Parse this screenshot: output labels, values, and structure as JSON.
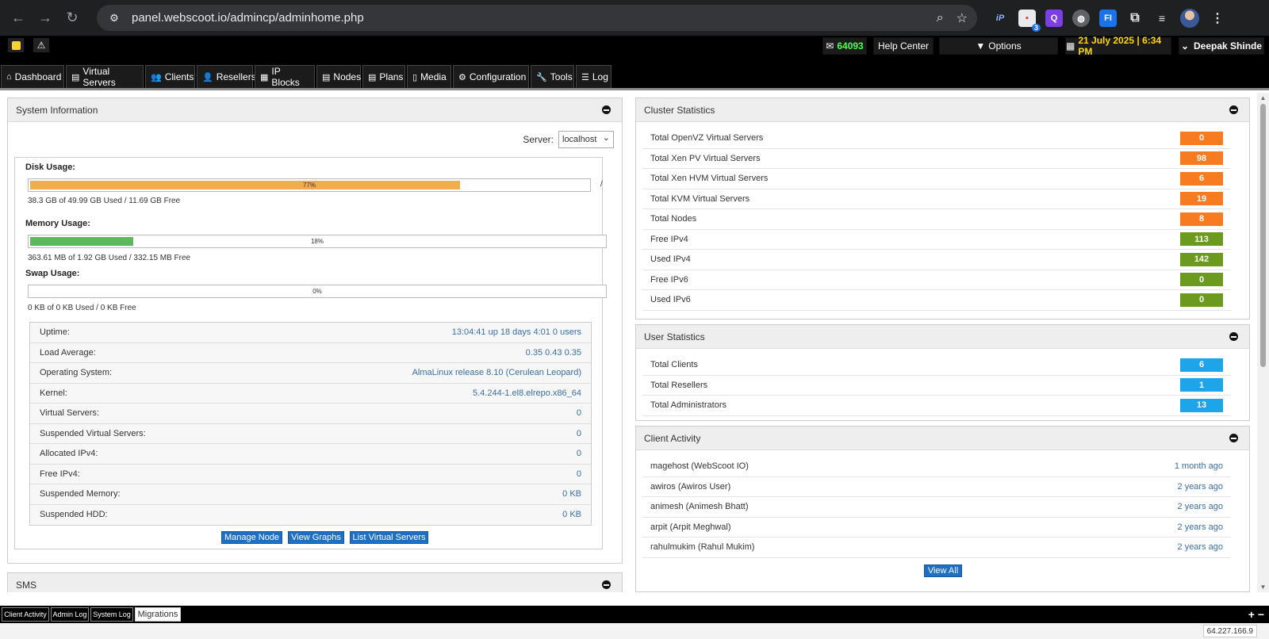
{
  "browser": {
    "url": "panel.webscoot.io/admincp/adminhome.php",
    "extension_badge": "3"
  },
  "topbar": {
    "messages_count": "64093",
    "help_center": "Help Center",
    "options": "Options",
    "date": "21 July 2025 | 6:34 PM",
    "user": "Deepak Shinde"
  },
  "nav": {
    "items": [
      "Dashboard",
      "Virtual Servers",
      "Clients",
      "Resellers",
      "IP Blocks",
      "Nodes",
      "Plans",
      "Media",
      "Configuration",
      "Tools",
      "Log"
    ]
  },
  "system_info": {
    "title": "System Information",
    "server_label": "Server:",
    "server_value": "localhost",
    "disk": {
      "title": "Disk Usage:",
      "percent_label": "77%",
      "percent": 77,
      "text": "38.3 GB of 49.99 GB Used / 11.69 GB Free",
      "mount": "/"
    },
    "memory": {
      "title": "Memory Usage:",
      "percent_label": "18%",
      "percent": 18,
      "text": "363.61 MB of 1.92 GB Used / 332.15 MB Free"
    },
    "swap": {
      "title": "Swap Usage:",
      "percent_label": "0%",
      "percent": 0,
      "text": "0 KB of 0 KB Used / 0 KB Free"
    },
    "rows": [
      {
        "label": "Uptime:",
        "value": "13:04:41 up 18 days 4:01 0 users"
      },
      {
        "label": "Load Average:",
        "value": "0.35 0.43 0.35"
      },
      {
        "label": "Operating System:",
        "value": "AlmaLinux release 8.10 (Cerulean Leopard)"
      },
      {
        "label": "Kernel:",
        "value": "5.4.244-1.el8.elrepo.x86_64"
      },
      {
        "label": "Virtual Servers:",
        "value": "0"
      },
      {
        "label": "Suspended Virtual Servers:",
        "value": "0"
      },
      {
        "label": "Allocated IPv4:",
        "value": "0"
      },
      {
        "label": "Free IPv4:",
        "value": "0"
      },
      {
        "label": "Suspended Memory:",
        "value": "0 KB"
      },
      {
        "label": "Suspended HDD:",
        "value": "0 KB"
      }
    ],
    "buttons": {
      "manage": "Manage Node",
      "graphs": "View Graphs",
      "list": "List Virtual Servers"
    }
  },
  "sms": {
    "title": "SMS"
  },
  "cluster": {
    "title": "Cluster Statistics",
    "rows": [
      {
        "label": "Total OpenVZ Virtual Servers",
        "value": "0",
        "color": "#f77b21"
      },
      {
        "label": "Total Xen PV Virtual Servers",
        "value": "98",
        "color": "#f77b21"
      },
      {
        "label": "Total Xen HVM Virtual Servers",
        "value": "6",
        "color": "#f77b21"
      },
      {
        "label": "Total KVM Virtual Servers",
        "value": "19",
        "color": "#f77b21"
      },
      {
        "label": "Total Nodes",
        "value": "8",
        "color": "#f77b21"
      },
      {
        "label": "Free IPv4",
        "value": "113",
        "color": "#6b9a1f"
      },
      {
        "label": "Used IPv4",
        "value": "142",
        "color": "#6b9a1f"
      },
      {
        "label": "Free IPv6",
        "value": "0",
        "color": "#6b9a1f"
      },
      {
        "label": "Used IPv6",
        "value": "0",
        "color": "#6b9a1f"
      }
    ]
  },
  "users": {
    "title": "User Statistics",
    "rows": [
      {
        "label": "Total Clients",
        "value": "6",
        "color": "#1ea4e9"
      },
      {
        "label": "Total Resellers",
        "value": "1",
        "color": "#1ea4e9"
      },
      {
        "label": "Total Administrators",
        "value": "13",
        "color": "#1ea4e9"
      }
    ]
  },
  "activity": {
    "title": "Client Activity",
    "rows": [
      {
        "name": "magehost (WebScoot IO)",
        "time": "1 month ago"
      },
      {
        "name": "awiros (Awiros User)",
        "time": "2 years ago"
      },
      {
        "name": "animesh (Animesh Bhatt)",
        "time": "2 years ago"
      },
      {
        "name": "arpit (Arpit Meghwal)",
        "time": "2 years ago"
      },
      {
        "name": "rahulmukim (Rahul Mukim)",
        "time": "2 years ago"
      }
    ],
    "view_all": "View All"
  },
  "bottom_tabs": [
    "Client Activity",
    "Admin Log",
    "System Log",
    "Migrations"
  ],
  "bottom_controls": "+ −",
  "footer_ip": "64.227.166.9"
}
